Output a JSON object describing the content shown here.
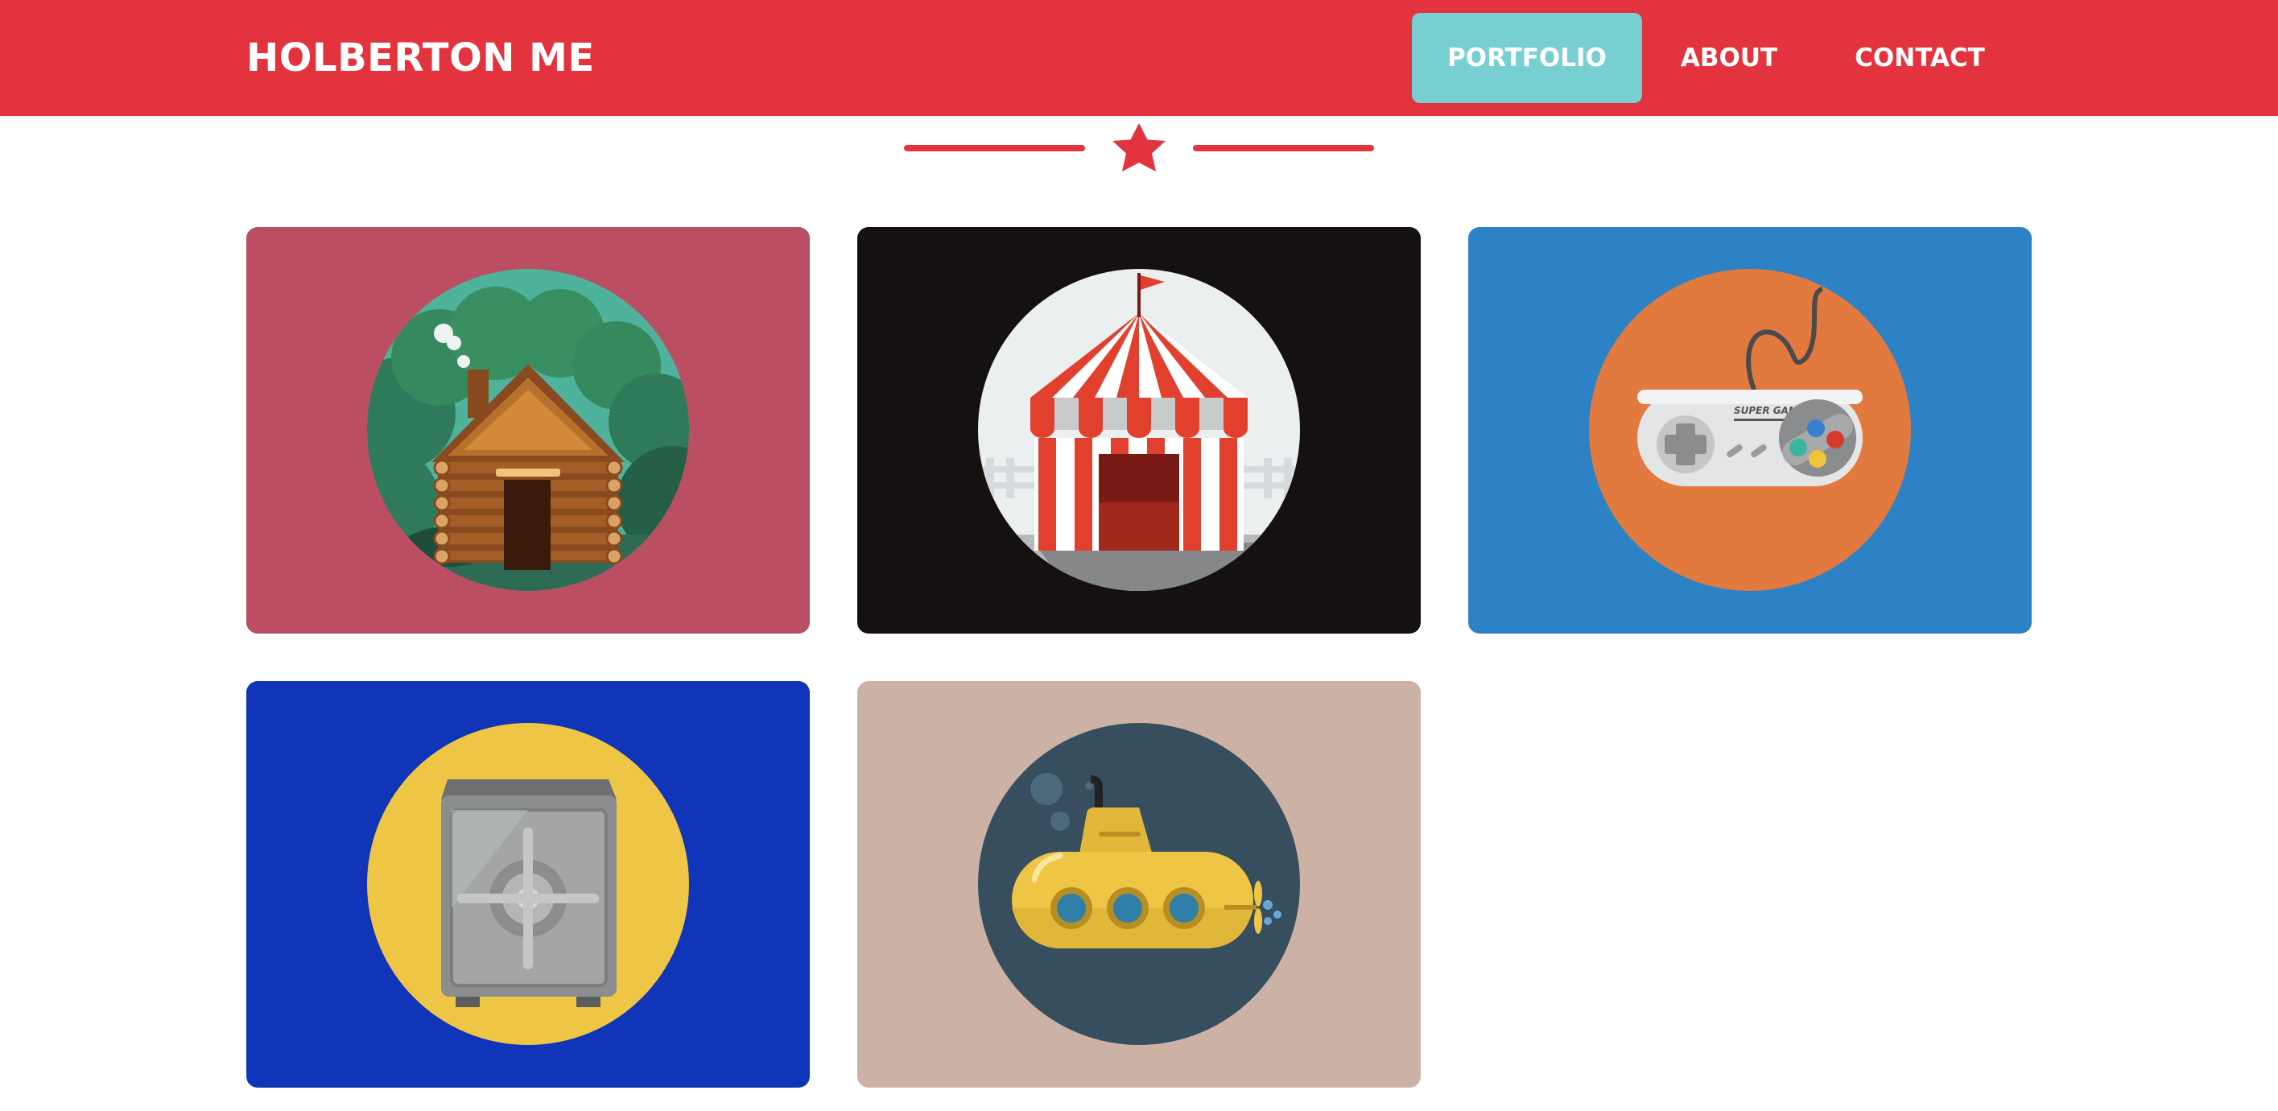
{
  "nav": {
    "brand": "HOLBERTON ME",
    "items": [
      {
        "label": "PORTFOLIO",
        "active": true
      },
      {
        "label": "ABOUT",
        "active": false
      },
      {
        "label": "CONTACT",
        "active": false
      }
    ]
  },
  "colors": {
    "navbar": "#e2333e",
    "active_tab": "#78cfd2",
    "divider": "#e2333e"
  },
  "divider_icon": "star-icon",
  "portfolio": [
    {
      "icon": "log-cabin-icon",
      "card_color": "#bc4e63",
      "circle_color": "#4fb39b"
    },
    {
      "icon": "circus-tent-icon",
      "card_color": "#141110",
      "circle_color": "#eceff0"
    },
    {
      "icon": "game-controller-icon",
      "card_color": "#2d82c5",
      "circle_color": "#e27a40",
      "controller_text": "SUPER GAME"
    },
    {
      "icon": "safe-icon",
      "card_color": "#1035b8",
      "circle_color": "#efc545"
    },
    {
      "icon": "submarine-icon",
      "card_color": "#ccb2a4",
      "circle_color": "#364e5e"
    }
  ]
}
